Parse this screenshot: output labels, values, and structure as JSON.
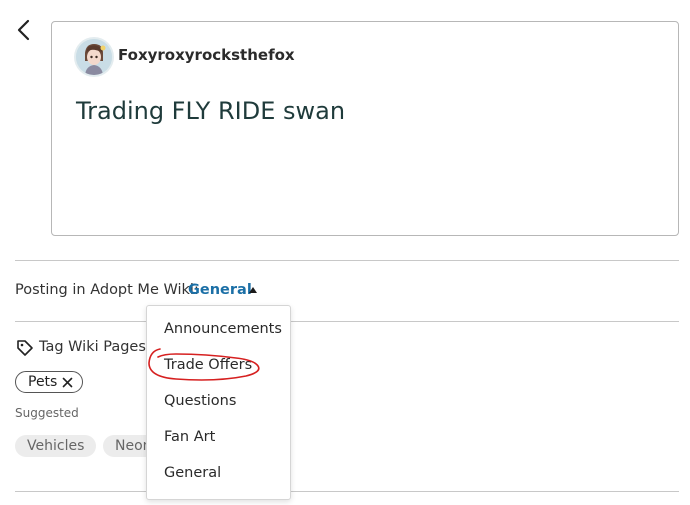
{
  "post": {
    "author": "Foxyroxyrocksthefox",
    "title": "Trading FLY RIDE swan"
  },
  "posting": {
    "prefix": "Posting in Adopt Me Wiki:",
    "selected_category": "General"
  },
  "dropdown": {
    "items": [
      "Announcements",
      "Trade Offers",
      "Questions",
      "Fan Art",
      "General"
    ]
  },
  "tags": {
    "header": "Tag Wiki Pages",
    "selected": [
      "Pets"
    ],
    "suggested_label": "Suggested",
    "suggested": [
      "Vehicles",
      "Neon"
    ]
  },
  "icons": {
    "back": "chevron-left-icon",
    "tag": "tag-icon",
    "remove": "close-icon",
    "caret": "caret-up-icon"
  },
  "colors": {
    "link": "#1b6fa6",
    "annotation": "#d62020"
  }
}
